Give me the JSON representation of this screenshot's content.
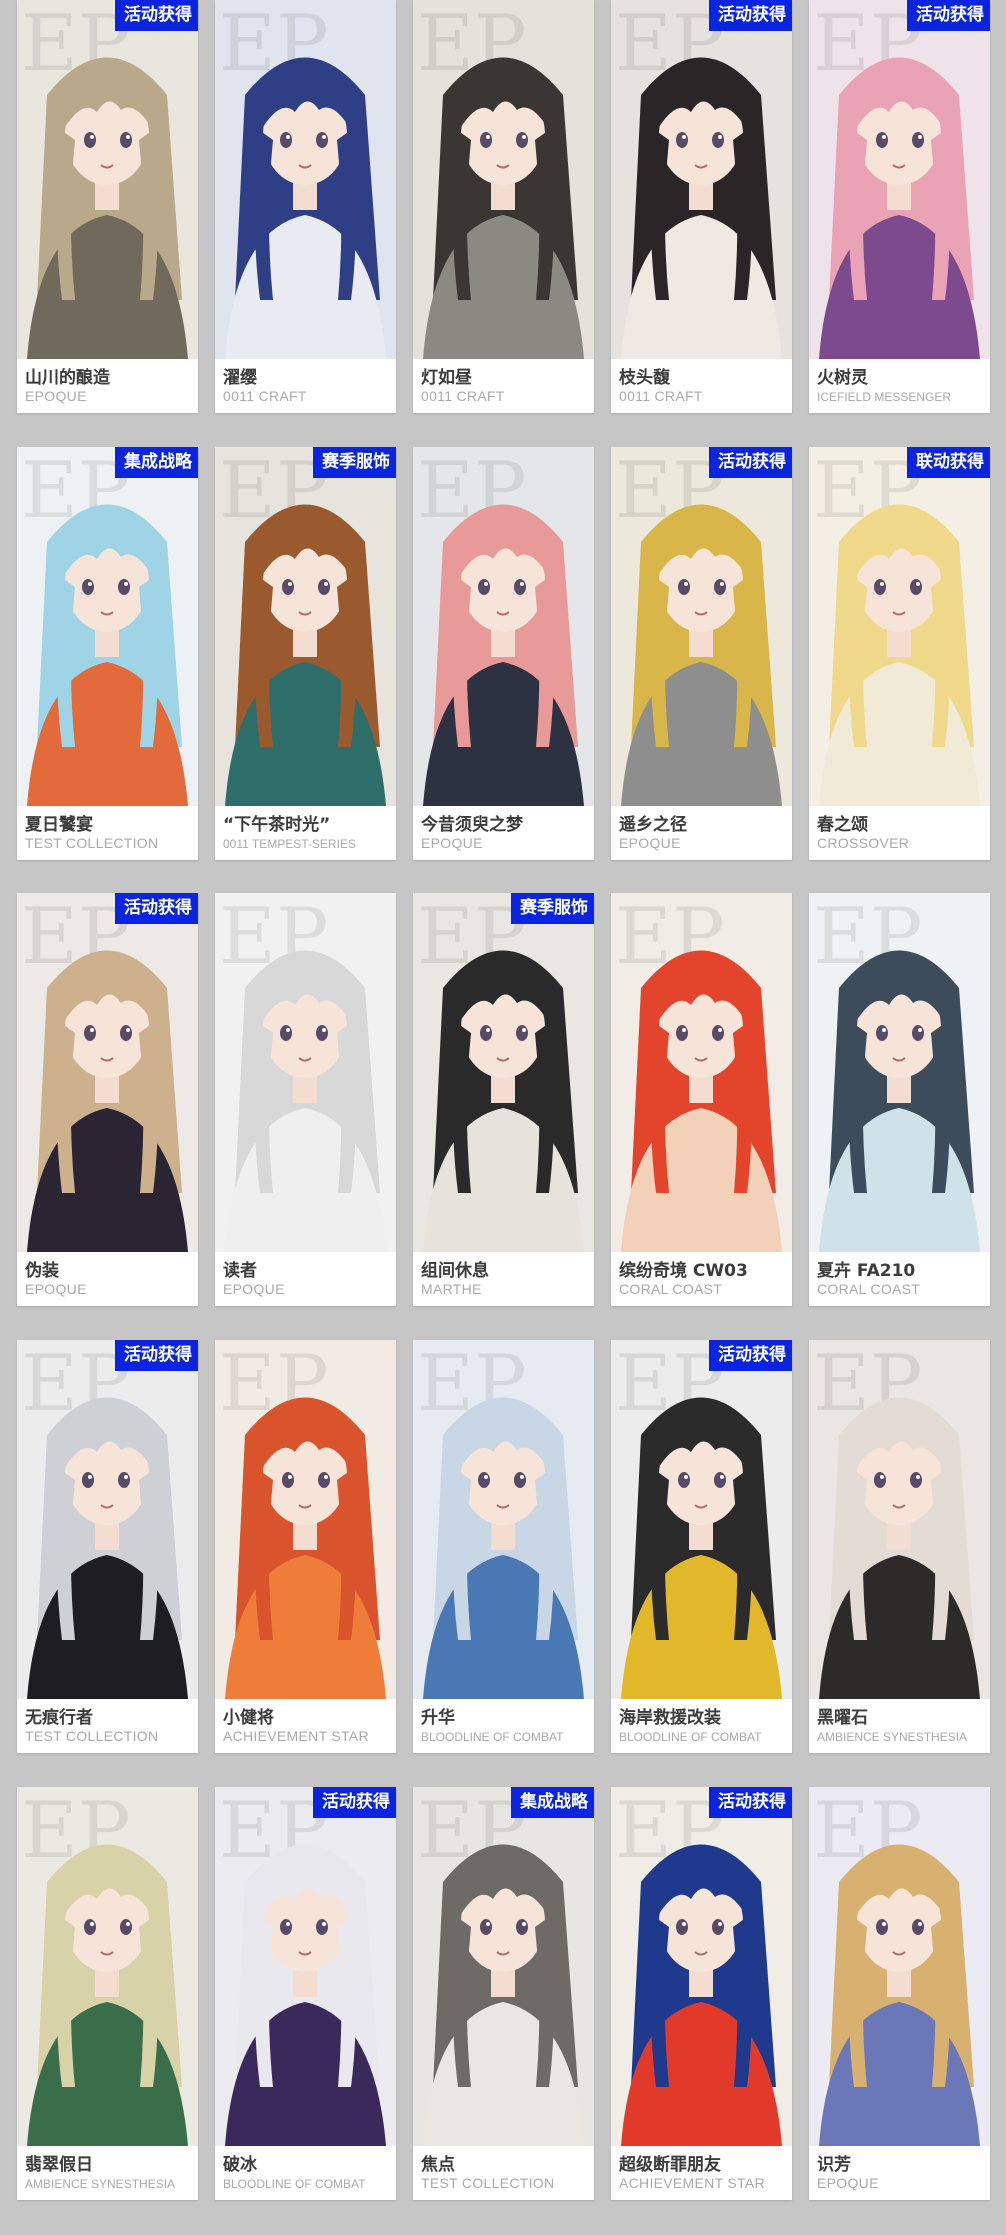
{
  "colors": {
    "background": "#c6c6c6",
    "card": "#ffffff",
    "badge": "#0a24e0",
    "name": "#3c3c3c",
    "series": "#a9a9a9"
  },
  "cards": [
    {
      "name": "山川的酿造",
      "series": "EPOQUE",
      "badge": "活动获得",
      "hair": "#b7a98a",
      "outfit": "#6f6a5c",
      "bg": "#e9e6de",
      "icon": "character-portrait-icon"
    },
    {
      "name": "濯缨",
      "series": "0011 CRAFT",
      "badge": "",
      "hair": "#2e3f86",
      "outfit": "#e8ecf2",
      "bg": "#dfe4ee",
      "icon": "character-portrait-icon"
    },
    {
      "name": "灯如昼",
      "series": "0011 CRAFT",
      "badge": "",
      "hair": "#3a3634",
      "outfit": "#8b8a82",
      "bg": "#e4e2da",
      "icon": "character-portrait-icon"
    },
    {
      "name": "枝头馥",
      "series": "0011 CRAFT",
      "badge": "活动获得",
      "hair": "#2a2526",
      "outfit": "#efe8e3",
      "bg": "#e6e2e0",
      "icon": "character-portrait-icon"
    },
    {
      "name": "火树灵",
      "series": "ICEFIELD MESSENGER",
      "badge": "活动获得",
      "hair": "#eaa3b5",
      "outfit": "#7d4a8e",
      "bg": "#efe3ea",
      "icon": "character-portrait-icon"
    },
    {
      "name": "夏日饕宴",
      "series": "TEST COLLECTION",
      "badge": "集成战略",
      "hair": "#9fd3e6",
      "outfit": "#e26a3b",
      "bg": "#eef1f3",
      "icon": "character-portrait-icon"
    },
    {
      "name": "“下午茶时光”",
      "series": "0011 TEMPEST-SERIES",
      "badge": "赛季服饰",
      "hair": "#9a5a2e",
      "outfit": "#2e6e6a",
      "bg": "#e7e4de",
      "icon": "character-portrait-icon"
    },
    {
      "name": "今昔须臾之梦",
      "series": "EPOQUE",
      "badge": "",
      "hair": "#e79a98",
      "outfit": "#2c3242",
      "bg": "#e5e6e9",
      "icon": "character-portrait-icon"
    },
    {
      "name": "遥乡之径",
      "series": "EPOQUE",
      "badge": "活动获得",
      "hair": "#d9b64a",
      "outfit": "#8e8e8e",
      "bg": "#ede8dc",
      "icon": "character-portrait-icon"
    },
    {
      "name": "春之颂",
      "series": "CROSSOVER",
      "badge": "联动获得",
      "hair": "#f0d98a",
      "outfit": "#f1ead6",
      "bg": "#f3efe4",
      "icon": "character-portrait-icon"
    },
    {
      "name": "伪装",
      "series": "EPOQUE",
      "badge": "活动获得",
      "hair": "#cdb08c",
      "outfit": "#2b2433",
      "bg": "#ece9e6",
      "icon": "character-portrait-icon"
    },
    {
      "name": "读者",
      "series": "EPOQUE",
      "badge": "",
      "hair": "#d8d8d8",
      "outfit": "#efefef",
      "bg": "#f1f1f1",
      "icon": "character-portrait-icon"
    },
    {
      "name": "组间休息",
      "series": "MARTHE",
      "badge": "赛季服饰",
      "hair": "#2a2a2a",
      "outfit": "#e6e3dc",
      "bg": "#e9e7e2",
      "icon": "character-portrait-icon"
    },
    {
      "name": "缤纷奇境 CW03",
      "series": "CORAL COAST",
      "badge": "",
      "hair": "#e2452c",
      "outfit": "#f3d1b8",
      "bg": "#f2ece6",
      "icon": "character-portrait-icon"
    },
    {
      "name": "夏卉 FA210",
      "series": "CORAL COAST",
      "badge": "",
      "hair": "#3d4c5a",
      "outfit": "#cfe2ea",
      "bg": "#eef2f4",
      "icon": "character-portrait-icon"
    },
    {
      "name": "无痕行者",
      "series": "TEST COLLECTION",
      "badge": "活动获得",
      "hair": "#cfd0d6",
      "outfit": "#1d1d22",
      "bg": "#ececec",
      "icon": "character-portrait-icon"
    },
    {
      "name": "小健将",
      "series": "ACHIEVEMENT STAR",
      "badge": "",
      "hair": "#d9542c",
      "outfit": "#ef7d3a",
      "bg": "#f1ebe3",
      "icon": "character-portrait-icon"
    },
    {
      "name": "升华",
      "series": "BLOODLINE OF COMBAT",
      "badge": "",
      "hair": "#c9d6e6",
      "outfit": "#4a78b4",
      "bg": "#e6ebf2",
      "icon": "character-portrait-icon"
    },
    {
      "name": "海岸救援改装",
      "series": "BLOODLINE OF COMBAT",
      "badge": "活动获得",
      "hair": "#2b2b2b",
      "outfit": "#e1b82a",
      "bg": "#ececec",
      "icon": "character-portrait-icon"
    },
    {
      "name": "黑曜石",
      "series": "AMBIENCE SYNESTHESIA",
      "badge": "",
      "hair": "#e3dcd5",
      "outfit": "#2d2a2a",
      "bg": "#e9e6e3",
      "icon": "character-portrait-icon"
    },
    {
      "name": "翡翠假日",
      "series": "AMBIENCE SYNESTHESIA",
      "badge": "",
      "hair": "#d8d2a8",
      "outfit": "#3a6e4a",
      "bg": "#ebeae2",
      "icon": "character-portrait-icon"
    },
    {
      "name": "破冰",
      "series": "BLOODLINE OF COMBAT",
      "badge": "活动获得",
      "hair": "#e8e8ee",
      "outfit": "#3a2a5c",
      "bg": "#ecebef",
      "icon": "character-portrait-icon"
    },
    {
      "name": "焦点",
      "series": "TEST COLLECTION",
      "badge": "集成战略",
      "hair": "#6e6a66",
      "outfit": "#eae6e2",
      "bg": "#e8e6e3",
      "icon": "character-portrait-icon"
    },
    {
      "name": "超级断罪朋友",
      "series": "ACHIEVEMENT STAR",
      "badge": "活动获得",
      "hair": "#1f3a8c",
      "outfit": "#e23a2a",
      "bg": "#f0ece6",
      "icon": "character-portrait-icon"
    },
    {
      "name": "识芳",
      "series": "EPOQUE",
      "badge": "",
      "hair": "#d8b070",
      "outfit": "#6a78b8",
      "bg": "#eceaf2",
      "icon": "character-portrait-icon"
    }
  ]
}
